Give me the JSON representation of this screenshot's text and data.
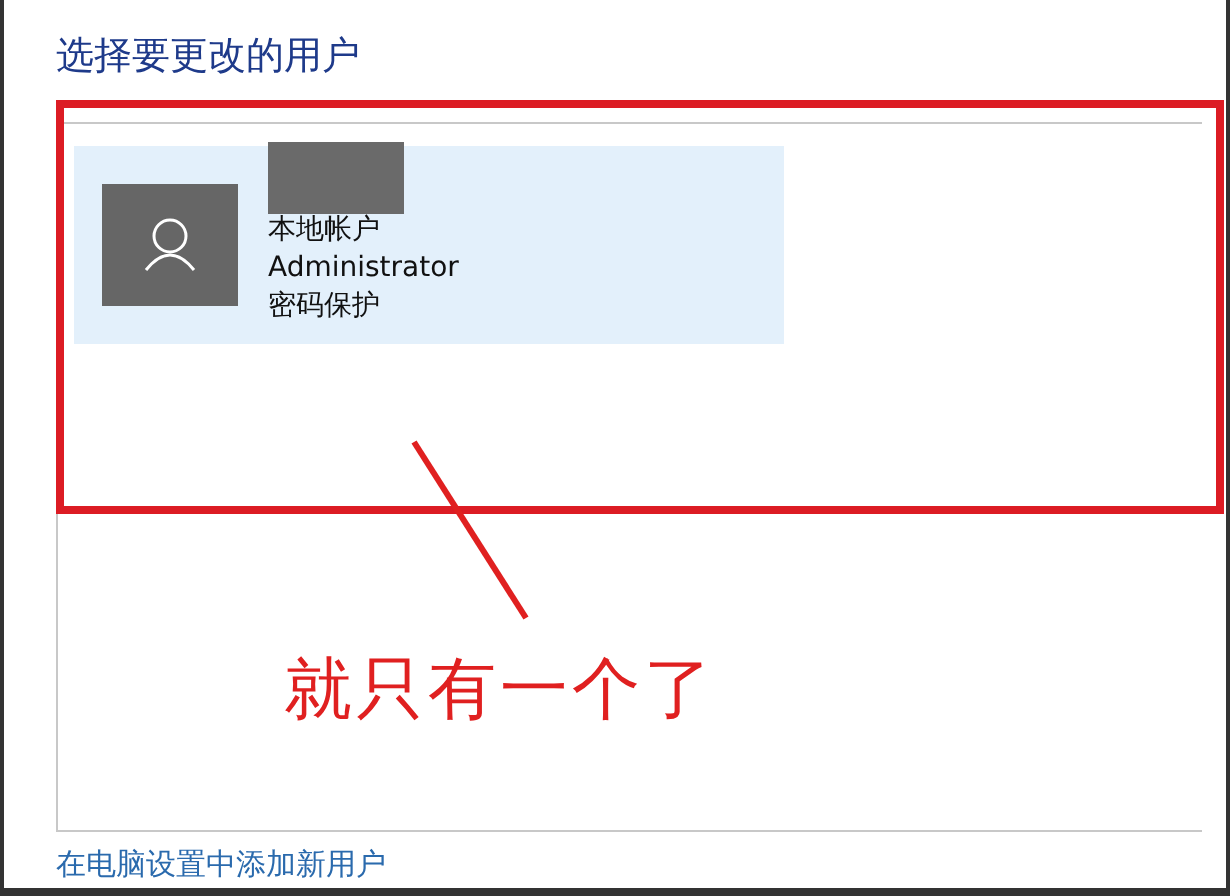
{
  "title": "选择要更改的用户",
  "users": [
    {
      "account_type": "本地帐户",
      "name_redacted": true,
      "role": "Administrator",
      "protection": "密码保护",
      "selected": true
    }
  ],
  "add_user_link": "在电脑设置中添加新用户",
  "annotation": {
    "text": "就只有一个了"
  }
}
